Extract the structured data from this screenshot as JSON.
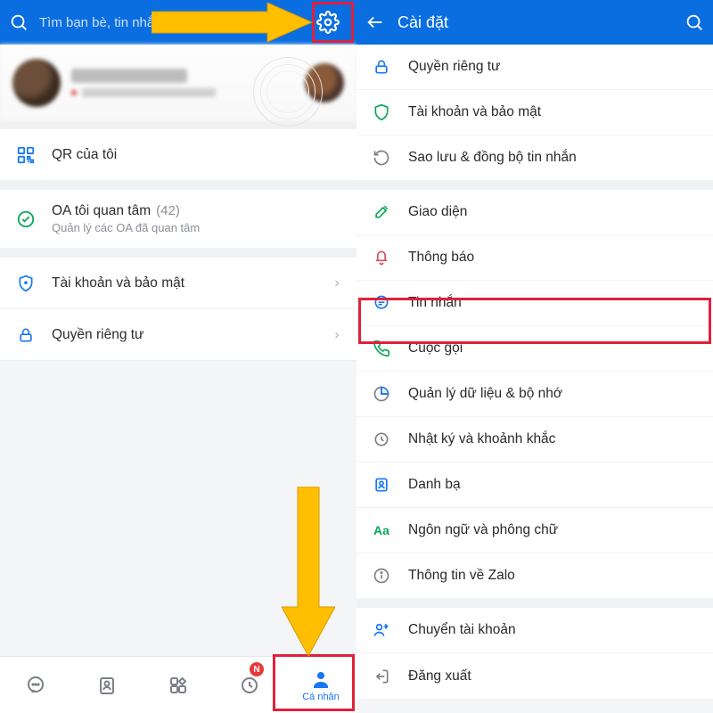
{
  "left": {
    "search_placeholder": "Tìm bạn bè, tin nhắn...",
    "qr_label": "QR của tôi",
    "oa_label": "OA tôi quan tâm",
    "oa_count": "(42)",
    "oa_sub": "Quản lý các OA đã quan tâm",
    "security_label": "Tài khoản và bảo mật",
    "privacy_label": "Quyền riêng tư",
    "nav": {
      "tab_badge": "N",
      "personal_label": "Cá nhân"
    }
  },
  "right": {
    "title": "Cài đặt",
    "items": {
      "privacy": "Quyền riêng tư",
      "account": "Tài khoản và bảo mật",
      "backup": "Sao lưu & đồng bộ tin nhắn",
      "theme": "Giao diện",
      "notif": "Thông báo",
      "message": "Tin nhắn",
      "call": "Cuộc gọi",
      "data": "Quản lý dữ liệu & bộ nhớ",
      "diary": "Nhật ký và khoảnh khắc",
      "contacts": "Danh bạ",
      "lang": "Ngôn ngữ và phông chữ",
      "about": "Thông tin về Zalo",
      "switch": "Chuyển tài khoản",
      "logout": "Đăng xuất"
    }
  }
}
